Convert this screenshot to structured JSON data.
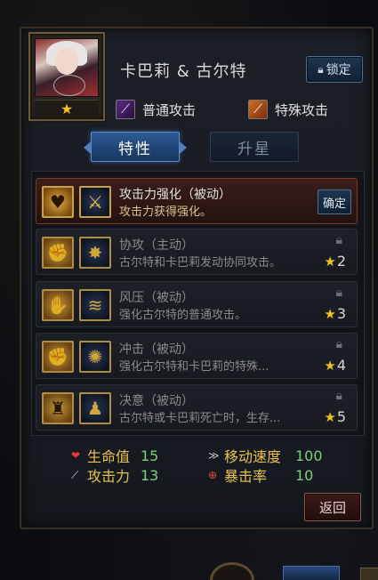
{
  "hero": {
    "name": "卡巴莉 & 古尔特",
    "star_glyph": "★",
    "lock_label": "锁定",
    "lock_icon": "lock-icon"
  },
  "attacks": {
    "normal_label": "普通攻击",
    "special_label": "特殊攻击"
  },
  "tabs": {
    "traits": "特性",
    "upgrade": "升星"
  },
  "skills": [
    {
      "title": "攻击力强化（被动）",
      "desc": "攻击力获得强化。",
      "action": "确定",
      "active": true
    },
    {
      "title": "协攻（主动）",
      "desc": "古尔特和卡巴莉发动协同攻击。",
      "req_star": "2"
    },
    {
      "title": "风压（被动）",
      "desc": "强化古尔特的普通攻击。",
      "req_star": "3"
    },
    {
      "title": "冲击（被动）",
      "desc": "强化古尔特和卡巴莉的特殊...",
      "req_star": "4"
    },
    {
      "title": "决意（被动）",
      "desc": "古尔特或卡巴莉死亡时，生存...",
      "req_star": "5"
    }
  ],
  "stats": {
    "hp_label": "生命值",
    "hp_value": "15",
    "atk_label": "攻击力",
    "atk_value": "13",
    "speed_label": "移动速度",
    "speed_value": "100",
    "crit_label": "暴击率",
    "crit_value": "10"
  },
  "buttons": {
    "return_label": "返回"
  },
  "colors": {
    "accent_blue": "#2c5a94",
    "star_gold": "#f3c21a",
    "stat_label": "#e8c24a",
    "stat_value": "#78d478"
  }
}
